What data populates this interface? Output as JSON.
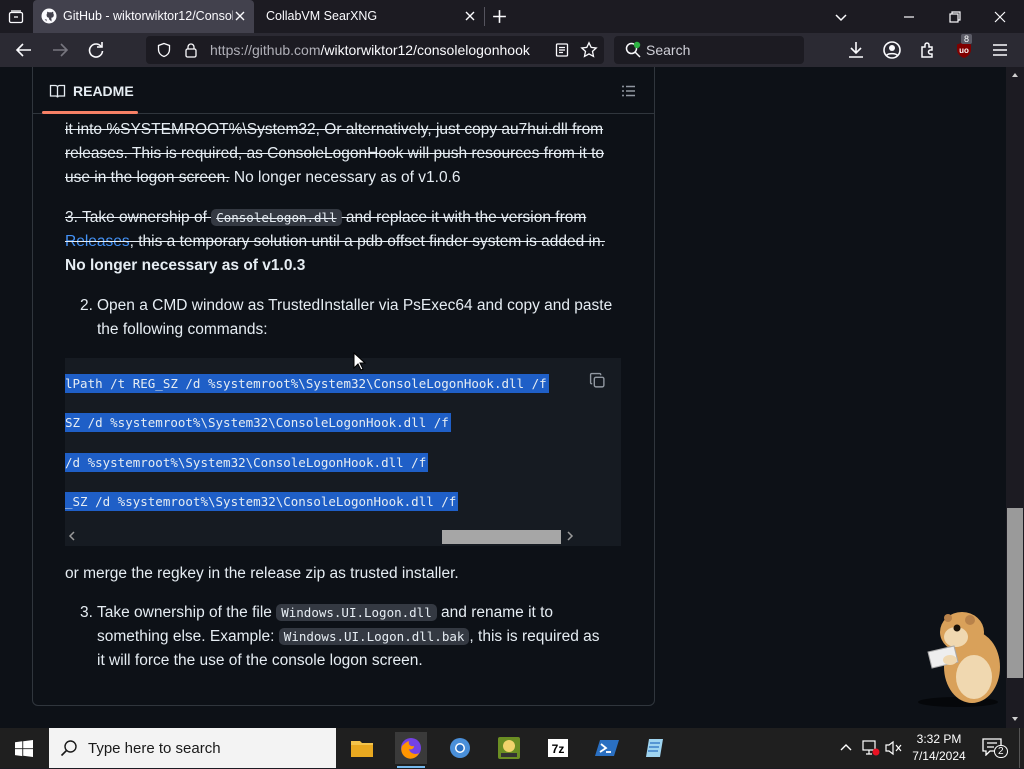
{
  "tabs": [
    {
      "title": "GitHub - wiktorwiktor12/Consol",
      "active": true
    },
    {
      "title": "CollabVM SearXNG",
      "active": false
    }
  ],
  "url": {
    "prefix": "https://github.com",
    "path": "/wiktorwiktor12/consolelogonhook"
  },
  "search_placeholder": "Search",
  "extension_badge": "8",
  "readme": {
    "label": "README",
    "p1_line1": "it into %SYSTEMROOT%\\System32, Or alternatively, just copy au7hui.dll from",
    "p1_line2": "releases. This is required, as ConsoleLogonHook will push resources from it to",
    "p1_line3_strike": "use in the logon screen.",
    "p1_line3_tail": " No longer necessary as of v1.0.6",
    "p2_prefix": "3. Take ownership of ",
    "p2_code": "ConsoleLogon.dll",
    "p2_suffix": " and replace it with the version from",
    "p2_link": "Releases",
    "p2_line2_rest": ", this a temporary solution until a pdb offset finder system is added in.",
    "p2_bold": "No longer necessary as of v1.0.3",
    "step2_num": "2.",
    "step2_line1": "Open a CMD window as TrustedInstaller via PsExec64 and copy and paste",
    "step2_line2": "the following commands:",
    "code_lines": [
      "lPath /t REG_SZ /d %systemroot%\\System32\\ConsoleLogonHook.dll /f",
      "SZ /d %systemroot%\\System32\\ConsoleLogonHook.dll /f",
      "/d %systemroot%\\System32\\ConsoleLogonHook.dll /f",
      "_SZ /d %systemroot%\\System32\\ConsoleLogonHook.dll /f"
    ],
    "merge_text": "or merge the regkey in the release zip as trusted installer.",
    "step3_num": "3.",
    "step3_a": "Take ownership of the file ",
    "step3_code1": "Windows.UI.Logon.dll",
    "step3_b": " and rename it to",
    "step3_c": "something else. Example: ",
    "step3_code2": "Windows.UI.Logon.dll.bak",
    "step3_d": ", this is required as",
    "step3_e": "it will force the use of the console logon screen."
  },
  "taskbar": {
    "search_placeholder": "Type here to search",
    "time": "3:32 PM",
    "date": "7/14/2024",
    "notification_count": "2"
  },
  "colors": {
    "page_bg": "#0d1117",
    "selection": "#1f5fc7",
    "link": "#4493f8",
    "readme_underline": "#f78166"
  }
}
